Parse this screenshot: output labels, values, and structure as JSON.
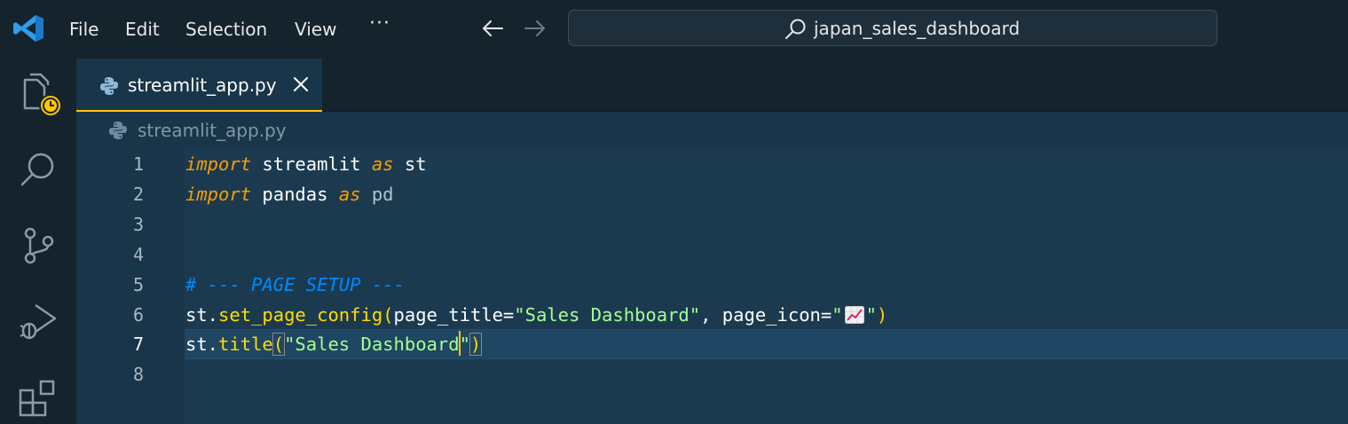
{
  "titlebar": {
    "menu": [
      "File",
      "Edit",
      "Selection",
      "View"
    ],
    "more": "···",
    "search_text": "japan_sales_dashboard"
  },
  "icons": {
    "logo": "vscode-logo-icon",
    "explorer": "files-icon",
    "search": "search-icon",
    "scm": "source-control-icon",
    "debug": "run-debug-icon",
    "extensions": "extensions-icon"
  },
  "tab": {
    "label": "streamlit_app.py",
    "close": "close-icon"
  },
  "breadcrumb": {
    "label": "streamlit_app.py"
  },
  "editor": {
    "line_numbers": [
      "1",
      "2",
      "3",
      "4",
      "5",
      "6",
      "7",
      "8"
    ],
    "active_line": 7,
    "lines": {
      "l1": {
        "kw1": "import",
        "name": " streamlit ",
        "kw2": "as",
        "alias": " st"
      },
      "l2": {
        "kw1": "import",
        "name": " pandas ",
        "kw2": "as",
        "alias": " pd"
      },
      "l5": {
        "comment": "# --- PAGE SETUP ---"
      },
      "l6": {
        "obj": "st.",
        "fn": "set_page_config",
        "open": "(",
        "arg1": "page_title=",
        "str1": "\"Sales Dashboard\"",
        "sep": ", ",
        "arg2": "page_icon=",
        "str2_open": "\"",
        "emoji": "chart-increasing-emoji",
        "str2_close": "\"",
        "close": ")"
      },
      "l7": {
        "obj": "st.",
        "fn": "title",
        "open": "(",
        "str": "\"Sales Dashboard",
        "str_close": "\"",
        "close": ")"
      }
    }
  },
  "colors": {
    "accent": "#ffc600",
    "background": "#193549",
    "sidebar": "#15232d",
    "keyword": "#ff9d00",
    "string": "#a5ff90",
    "function": "#ffdd00",
    "comment": "#0088ff"
  }
}
